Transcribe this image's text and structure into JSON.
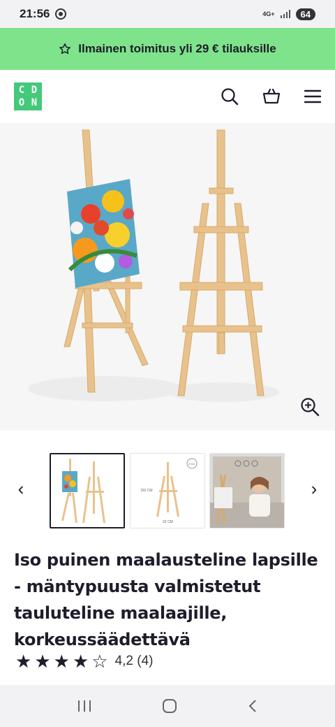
{
  "status_bar": {
    "time": "21:56",
    "network": "4G+",
    "battery": "64"
  },
  "promo": {
    "icon": "star-outline-icon",
    "text": "Ilmainen toimitus yli 29 € tilauksille",
    "color": "#7ee38a"
  },
  "header": {
    "logo_letters": [
      "C",
      "D",
      "O",
      "N"
    ],
    "logo_color": "#44c87a",
    "icons": [
      "search-icon",
      "basket-icon",
      "menu-icon"
    ]
  },
  "product": {
    "title": "Iso puinen maalausteline lapsille - mäntypuusta valmistetut tauluteline maalaajille, korkeussäädettävä",
    "rating": {
      "stars": 4,
      "max": 5,
      "text": "4,2 (4)"
    },
    "thumbnails": [
      {
        "description": "easel-with-painting",
        "selected": true
      },
      {
        "description": "easel-dimensions",
        "selected": false
      },
      {
        "description": "woman-painting",
        "selected": false
      }
    ],
    "thumbnail_labels": {
      "height": "150 CM",
      "width": "32 CM",
      "weight": "2 KG"
    }
  },
  "nav": {
    "icons": [
      "recent-apps-icon",
      "home-icon",
      "back-icon"
    ]
  }
}
